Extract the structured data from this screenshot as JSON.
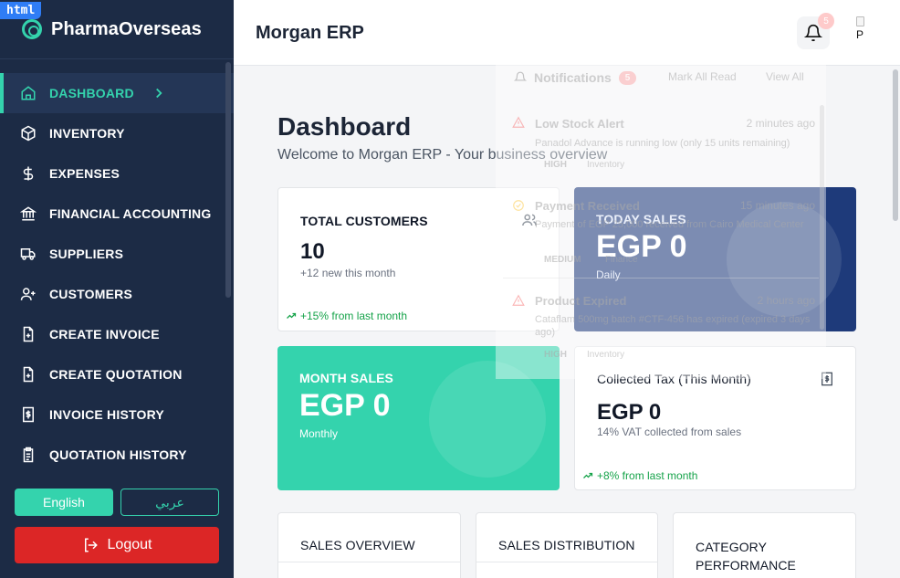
{
  "badge": "html",
  "brand": {
    "name": "PharmaOverseas"
  },
  "sidebar": {
    "items": [
      {
        "label": "DASHBOARD",
        "icon": "home-icon",
        "active": true
      },
      {
        "label": "INVENTORY",
        "icon": "box-icon"
      },
      {
        "label": "EXPENSES",
        "icon": "dollar-icon"
      },
      {
        "label": "FINANCIAL ACCOUNTING",
        "icon": "bank-icon"
      },
      {
        "label": "SUPPLIERS",
        "icon": "truck-icon"
      },
      {
        "label": "CUSTOMERS",
        "icon": "user-plus-icon"
      },
      {
        "label": "CREATE INVOICE",
        "icon": "file-plus-icon"
      },
      {
        "label": "CREATE QUOTATION",
        "icon": "file-plus-icon"
      },
      {
        "label": "INVOICE HISTORY",
        "icon": "receipt-icon"
      },
      {
        "label": "QUOTATION HISTORY",
        "icon": "clipboard-icon"
      }
    ],
    "lang_en": "English",
    "lang_ar": "عربي",
    "logout": "Logout"
  },
  "header": {
    "title": "Morgan ERP",
    "bell_count": "5",
    "avatar_alt": "P"
  },
  "main": {
    "title": "Dashboard",
    "subtitle": "Welcome to Morgan ERP - Your business overview"
  },
  "cards": {
    "customers": {
      "label": "TOTAL CUSTOMERS",
      "value": "10",
      "sub": "+12 new this month",
      "trend": "+15% from last month"
    },
    "today": {
      "label": "TODAY SALES",
      "value": "EGP 0",
      "sub": "Daily"
    },
    "month": {
      "label": "MONTH SALES",
      "value": "EGP 0",
      "sub": "Monthly"
    },
    "tax": {
      "label": "Collected Tax (This Month)",
      "value": "EGP 0",
      "sub": "14% VAT collected from sales",
      "trend": "+8% from last month"
    }
  },
  "panels": {
    "sales_overview": "SALES OVERVIEW",
    "sales_distribution": "SALES DISTRIBUTION",
    "category_performance": "CATEGORY PERFORMANCE"
  },
  "notifications": {
    "title": "Notifications",
    "count": "5",
    "mark_all": "Mark All Read",
    "view_all": "View All",
    "items": [
      {
        "title": "Low Stock Alert",
        "time": "2 minutes ago",
        "message": "Panadol Advance is running low (only 15 units remaining)",
        "priority": "HIGH",
        "category": "Inventory"
      },
      {
        "title": "Payment Received",
        "time": "15 minutes ago",
        "message": "Payment of EGP 25,000 received from Cairo Medical Center",
        "priority": "MEDIUM",
        "category": "Finance"
      },
      {
        "title": "Product Expired",
        "time": "2 hours ago",
        "message": "Cataflam 500mg batch #CTF-456 has expired (expired 3 days ago)",
        "priority": "HIGH",
        "category": "Inventory"
      }
    ]
  },
  "colors": {
    "sidebar": "#1c2b45",
    "accent": "#34d3ad",
    "navy_card": "#1e3a7a",
    "danger": "#dc2626"
  }
}
